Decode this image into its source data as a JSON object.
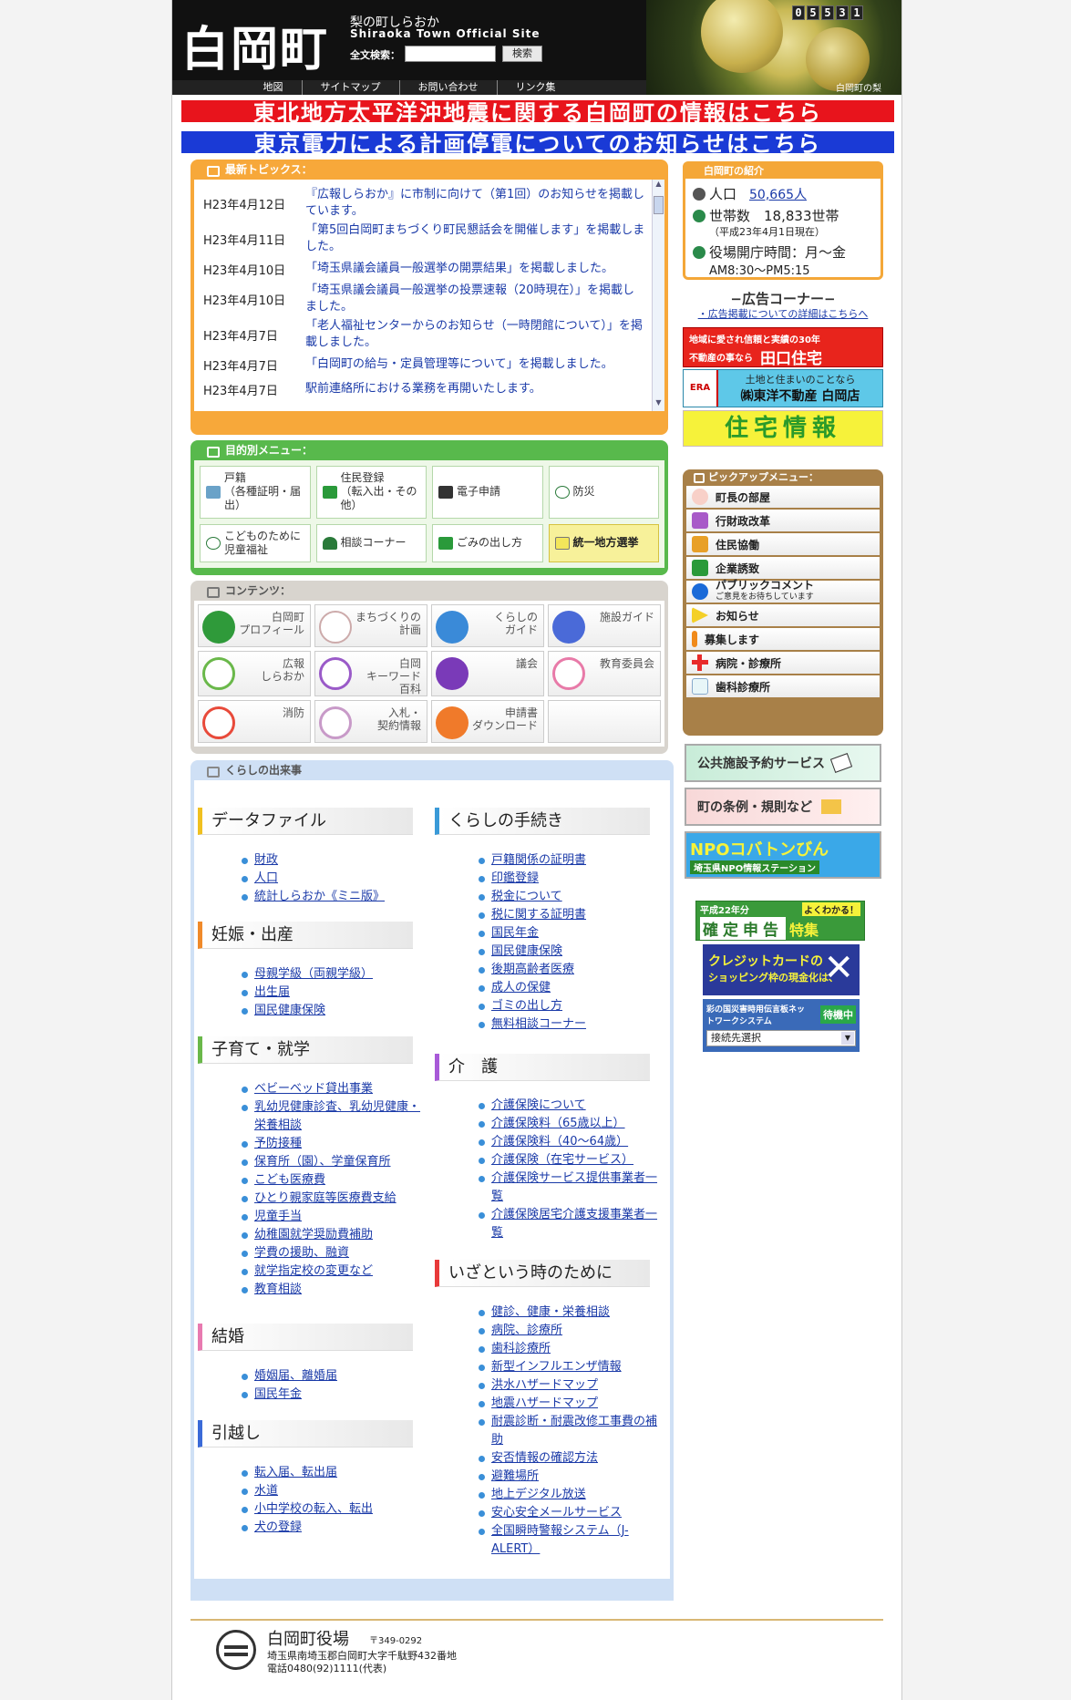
{
  "header": {
    "logo": "白岡町",
    "tagline": "梨の町しらおか",
    "site_name": "Shiraoka Town Official Site",
    "search_label": "全文検索：",
    "search_button": "検索",
    "counter": [
      "0",
      "5",
      "5",
      "3",
      "1"
    ],
    "nav": [
      "地図",
      "サイトマップ",
      "お問い合わせ",
      "リンク集"
    ],
    "photo_caption": "白岡町の梨"
  },
  "banners": {
    "earthquake": "東北地方太平洋沖地震に関する白岡町の情報はこちら",
    "outage": "東京電力による計画停電についてのお知らせはこちら"
  },
  "topics": {
    "title": "最新トピックス：",
    "items": [
      {
        "date": "H23年4月12日",
        "text": "『広報しらおか』に市制に向けて（第1回）のお知らせを掲載しています。"
      },
      {
        "date": "H23年4月11日",
        "text": "「第5回白岡町まちづくり町民懇話会を開催します」を掲載しました。"
      },
      {
        "date": "H23年4月10日",
        "text": "「埼玉県議会議員一般選挙の開票結果」を掲載しました。"
      },
      {
        "date": "H23年4月10日",
        "text": "「埼玉県議会議員一般選挙の投票速報（20時現在）」を掲載しました。"
      },
      {
        "date": "H23年4月7日",
        "text": "「老人福祉センターからのお知らせ（一時閉館について）」を掲載しました。"
      },
      {
        "date": "H23年4月7日",
        "text": "「白岡町の給与・定員管理等について」を掲載しました。"
      },
      {
        "date": "H23年4月7日",
        "text": "駅前連絡所における業務を再開いたします。"
      }
    ]
  },
  "purpose": {
    "title": "目的別メニュー：",
    "items": [
      "戸籍\n（各種証明・届出）",
      "住民登録\n（転入出・その他）",
      "電子申請",
      "防災",
      "こどものために\n児童福祉",
      "相談コーナー",
      "ごみの出し方",
      "統一地方選挙"
    ]
  },
  "contents": {
    "title": "コンテンツ：",
    "items": [
      "白岡町\nプロフィール",
      "まちづくりの\n計画",
      "くらしの\nガイド",
      "施設ガイド",
      "広報\nしらおか",
      "白岡\nキーワード\n百科",
      "議会",
      "教育委員会",
      "消防",
      "入札・\n契約情報",
      "申請書\nダウンロード",
      ""
    ]
  },
  "life": {
    "title": "くらしの出来事",
    "left": [
      {
        "title": "データファイル",
        "items": [
          "財政",
          "人口",
          "統計しらおか《ミニ版》"
        ]
      },
      {
        "title": "妊娠・出産",
        "items": [
          "母親学級（両親学級）",
          "出生届",
          "国民健康保険"
        ]
      },
      {
        "title": "子育て・就学",
        "items": [
          "ベビーベッド貸出事業",
          "乳幼児健康診査、乳幼児健康・栄養相談",
          "予防接種",
          "保育所（園）、学童保育所",
          "こども医療費",
          "ひとり親家庭等医療費支給",
          "児童手当",
          "幼稚園就学奨励費補助",
          "学費の援助、融資",
          "就学指定校の変更など",
          "教育相談"
        ]
      },
      {
        "title": "結婚",
        "items": [
          "婚姻届、離婚届",
          "国民年金"
        ]
      },
      {
        "title": "引越し",
        "items": [
          "転入届、転出届",
          "水道",
          "小中学校の転入、転出",
          "犬の登録"
        ]
      }
    ],
    "right": [
      {
        "title": "くらしの手続き",
        "items": [
          "戸籍関係の証明書",
          "印鑑登録",
          "税金について",
          "税に関する証明書",
          "国民年金",
          "国民健康保険",
          "後期高齢者医療",
          "成人の保健",
          "ゴミの出し方",
          "無料相談コーナー"
        ]
      },
      {
        "title": "介　護",
        "items": [
          "介護保険について",
          "介護保険料（65歳以上）",
          "介護保険料（40〜64歳）",
          "介護保険（在宅サービス）",
          "介護保険サービス提供事業者一覧",
          "介護保険居宅介護支援事業者一覧"
        ]
      },
      {
        "title": "いざという時のために",
        "items": [
          "健診、健康・栄養相談",
          "病院、診療所",
          "歯科診療所",
          "新型インフルエンザ情報",
          "洪水ハザードマップ",
          "地震ハザードマップ",
          "耐震診断・耐震改修工事費の補助",
          "安否情報の確認方法",
          "避難場所",
          "地上デジタル放送",
          "安心安全メールサービス",
          "全国瞬時警報システム（J-ALERT）"
        ]
      }
    ]
  },
  "intro": {
    "title": "白岡町の紹介",
    "population_label": "人口",
    "population": "50,665人",
    "households": "世帯数　18,833世帯",
    "as_of": "（平成23年4月1日現在）",
    "hours_label": "役場開庁時間：月〜金",
    "hours": "AM8:30〜PM5:15"
  },
  "ads": {
    "title": "−広告コーナー−",
    "link": "・広告掲載についての詳細はこちらへ",
    "ad1_line1": "地域に愛され信頼と実績の30年",
    "ad1_line2": "不動産の事なら",
    "ad1_brand": "田口住宅",
    "ad2_line1": "土地と住まいのことなら",
    "ad2_brand": "㈱東洋不動産 白岡店",
    "ad3": "住宅情報"
  },
  "pickup": {
    "title": "ピックアップメニュー：",
    "items": [
      "町長の部屋",
      "行財政改革",
      "住民協働",
      "企業誘致",
      "パブリックコメント",
      "お知らせ",
      "募集します",
      "病院・診療所",
      "歯科診療所"
    ],
    "public_comment_sub": "ご意見をお待ちしています"
  },
  "side_buttons": {
    "reserve": "公共施設予約サービス",
    "rules": "町の条例・規則など",
    "npo": "NPOコバトンびん",
    "npo_sub": "埼玉県NPO情報ステーション",
    "tax_top": "平成22年分",
    "tax_top_right": "よくわかる！",
    "tax_main": "確定申告",
    "tax_special": "特集",
    "credit": "クレジットカードの",
    "credit_sub": "ショッピング枠の現金化は、",
    "disaster_net": "彩の国災害時用伝言板ネットワークシステム",
    "disaster_status": "待機中",
    "disaster_select": "接続先選択"
  },
  "footer": {
    "name": "白岡町役場",
    "zip": "〒349-0292",
    "address": "埼玉県南埼玉郡白岡町大字千駄野432番地",
    "tel": "電話0480(92)1111(代表)"
  },
  "colors": {
    "banner_red": "#e8141c",
    "banner_blue": "#1a3ad6",
    "topics_orange": "#f7a83a",
    "purpose_green": "#58b94c",
    "pickup_brown": "#a88048"
  }
}
